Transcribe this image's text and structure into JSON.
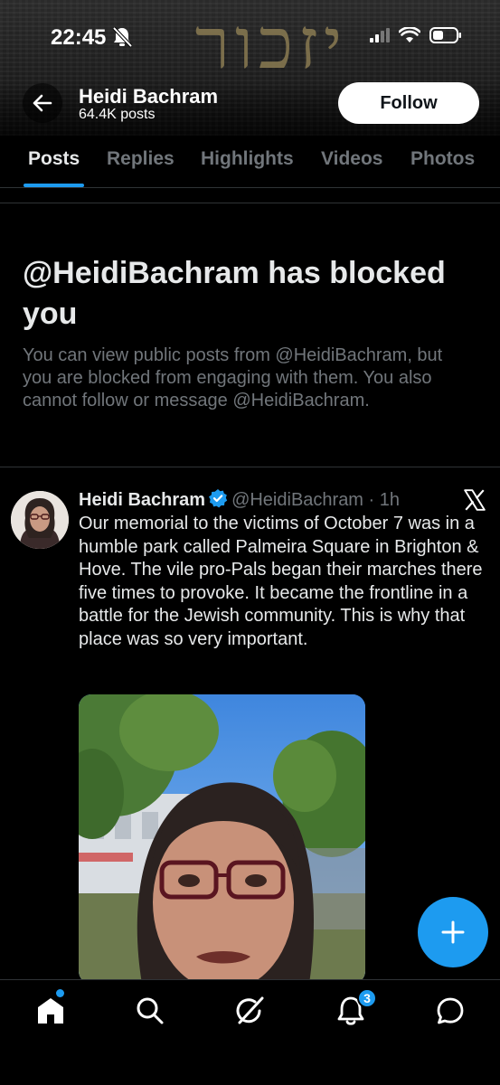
{
  "status_bar": {
    "time": "22:45"
  },
  "banner": {
    "hebrew_text": "יזכור"
  },
  "header": {
    "name": "Heidi Bachram",
    "post_count": "64.4K posts",
    "follow_label": "Follow"
  },
  "tabs": [
    {
      "label": "Posts",
      "active": true
    },
    {
      "label": "Replies",
      "active": false
    },
    {
      "label": "Highlights",
      "active": false
    },
    {
      "label": "Videos",
      "active": false
    },
    {
      "label": "Photos",
      "active": false
    }
  ],
  "blocked": {
    "title": "@HeidiBachram has blocked you",
    "description": "You can view public posts from @HeidiBachram, but you are blocked from engaging with them. You also cannot follow or message @HeidiBachram."
  },
  "post": {
    "author": "Heidi Bachram",
    "handle": "@HeidiBachram",
    "separator": "·",
    "time": "1h",
    "text": "Our memorial to the victims of October 7 was in a humble park called Palmeira Square in Brighton & Hove. The vile pro-Pals began their marches there five times to provoke. It became the frontline in a battle for the Jewish community. This is why that place was so very important."
  },
  "bottom_nav": {
    "items": [
      "home-icon",
      "search-icon",
      "grok-icon",
      "notifications-icon",
      "messages-icon"
    ],
    "notification_count": "3"
  },
  "colors": {
    "accent": "#1d9bf0",
    "background": "#000000",
    "text_primary": "#e7e9ea",
    "text_secondary": "#71767b"
  }
}
